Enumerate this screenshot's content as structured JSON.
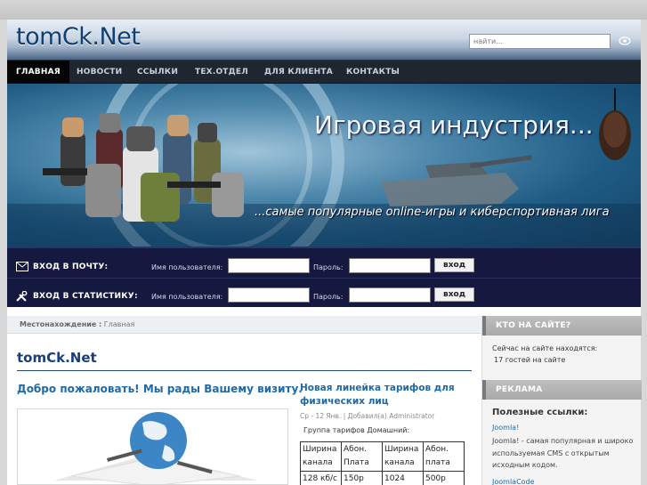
{
  "site": {
    "logo": "tomCk.Net",
    "search_placeholder": "найти..."
  },
  "nav": {
    "items": [
      {
        "label": "ГЛАВНАЯ"
      },
      {
        "label": "НОВОСТИ"
      },
      {
        "label": "ССЫЛКИ"
      },
      {
        "label": "ТЕХ.ОТДЕЛ"
      },
      {
        "label": "ДЛЯ КЛИЕНТА"
      },
      {
        "label": "КОНТАКТЫ"
      }
    ]
  },
  "banner": {
    "title": "Игровая индустрия...",
    "subtitle": "...самые популярные online-игры и киберспортивная лига"
  },
  "login": {
    "mail_title": "ВХОД В ПОЧТУ:",
    "stats_title": "ВХОД В СТАТИСТИКУ:",
    "username_label": "Имя пользователя:",
    "password_label": "Пароль:",
    "button": "вход"
  },
  "main": {
    "breadcrumb_label": "Местонахождение :",
    "breadcrumb_current": "Главная",
    "page_title": "tomCk.Net",
    "welcome": "Добро пожаловать! Мы рады Вашему визиту.",
    "article": {
      "title": "Новая линейка тарифов для физических лиц",
      "meta": "Ср - 12 Янв.  | Добавил(а) Administrator",
      "group": "Группа тарифов Домашний:",
      "table_rows": [
        [
          "Ширина канала",
          "Абон. Плата",
          "Ширина канала",
          "Абон. плата"
        ],
        [
          "128 кб/с",
          "150р",
          "1024",
          "500р"
        ]
      ]
    }
  },
  "sidebar": {
    "online_title": "КТО НА САЙТЕ?",
    "online_line1": "Сейчас на сайте находятся:",
    "online_line2": "17 гостей на сайте",
    "ads_title": "РЕКЛАМА",
    "links_title": "Полезные ссылки:",
    "link1": "Joomla!",
    "link1_desc": "Joomla! - самая популярная и широко используемая CMS с открытым исходным кодом.",
    "link2": "JoomlaCode"
  },
  "colors": {
    "nav_bg": "#1f2630",
    "login_bg": "#15183f",
    "link": "#1f6aa5",
    "title": "#1b3d7a"
  }
}
